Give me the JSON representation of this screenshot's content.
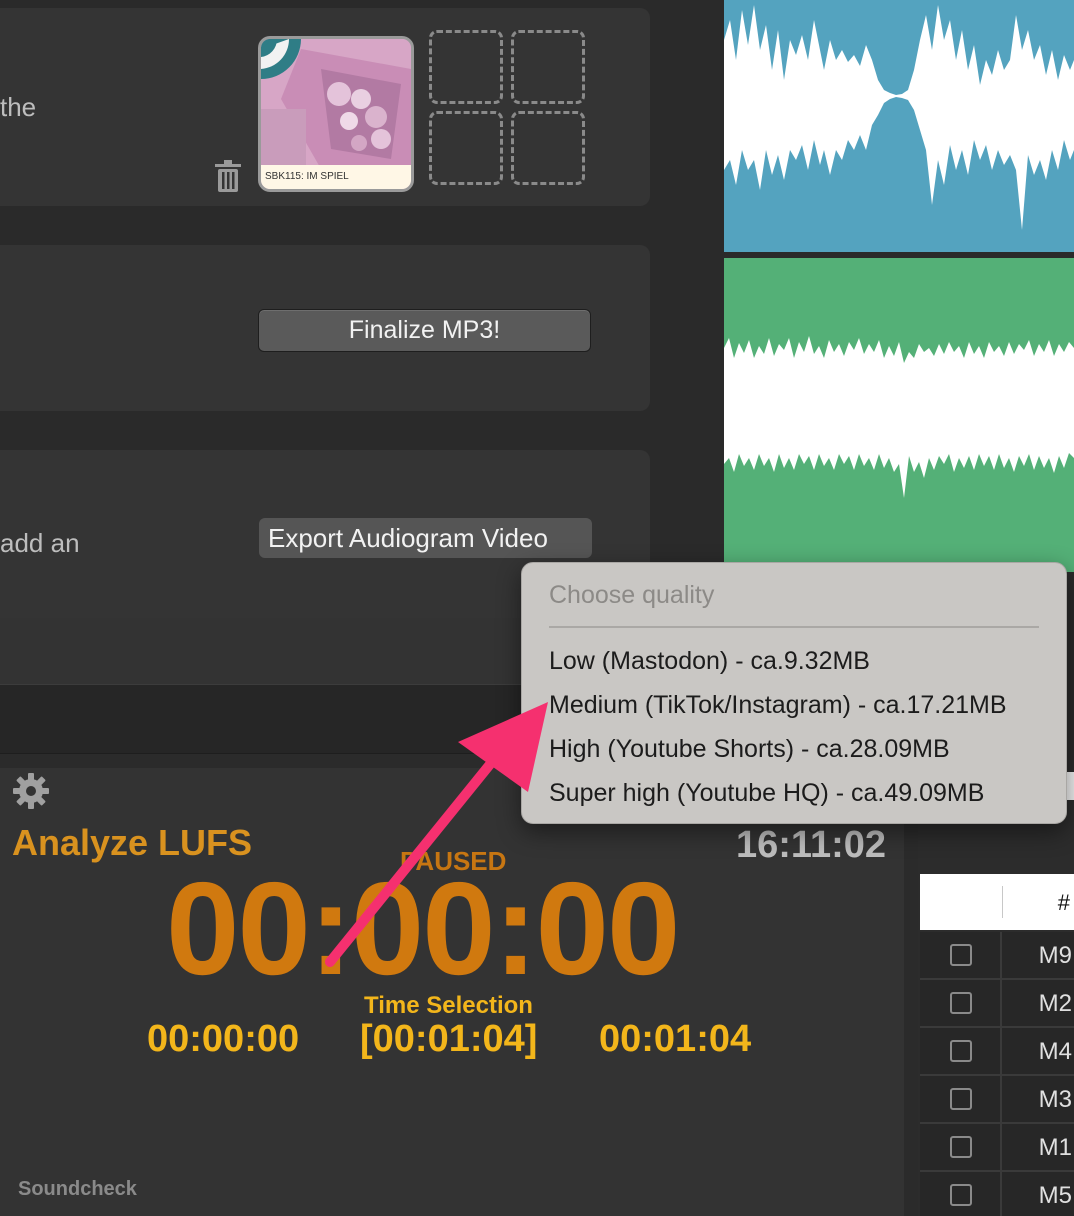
{
  "cards": {
    "artwork_text": "the",
    "audiogram_text": "add an",
    "thumbnail_label": "SBK115: IM SPIEL",
    "finalize_label": "Finalize MP3!",
    "export_label": "Export Audiogram Video"
  },
  "transport": {
    "analyze_label": "Analyze LUFS",
    "clock": "16:11:02",
    "status": "PAUSED",
    "main_time": "00:00:00",
    "selection_label": "Time Selection",
    "selection_start": "00:00:00",
    "selection_length": "[00:01:04]",
    "selection_end": "00:01:04",
    "soundcheck_label": "Soundcheck"
  },
  "markers_table": {
    "header_hash": "#",
    "rows": [
      "M9",
      "M2",
      "M4",
      "M3",
      "M1",
      "M5"
    ]
  },
  "quality_menu": {
    "title": "Choose quality",
    "items": [
      "Low (Mastodon) - ca.9.32MB",
      "Medium (TikTok/Instagram) - ca.17.21MB",
      "High (Youtube Shorts) - ca.28.09MB",
      "Super high (Youtube HQ) - ca.49.09MB"
    ]
  },
  "colors": {
    "accent_orange": "#d0790f",
    "accent_yellow": "#f3b61b",
    "waveform_blue": "#54a3bf",
    "waveform_green": "#54b077",
    "annotation_arrow": "#f5306f"
  },
  "icons": [
    "trash-icon",
    "gear-icon",
    "checkbox-icon"
  ]
}
